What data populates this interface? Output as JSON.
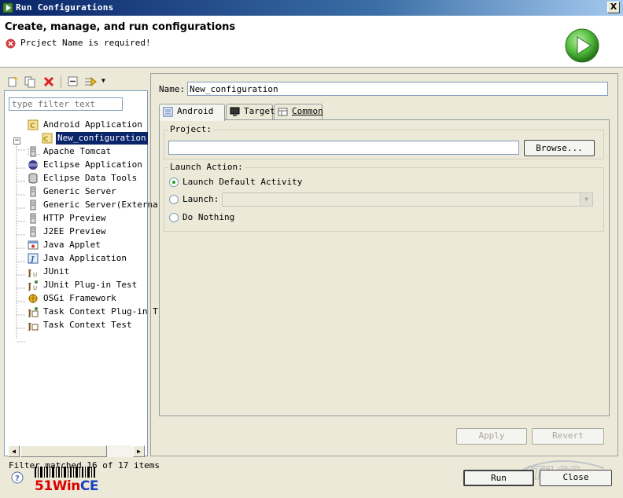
{
  "window": {
    "title": "Run Configurations",
    "close_glyph": "X"
  },
  "banner": {
    "title": "Create, manage, and run configurations",
    "error_message": "Prcject Name is required!"
  },
  "left": {
    "filter_placeholder": "type filter text",
    "tree": [
      {
        "label": "Android Application",
        "icon": "android-app-icon"
      },
      {
        "label": "New_configuration",
        "icon": "configuration-icon"
      },
      {
        "label": "Apache Tomcat",
        "icon": "server-icon"
      },
      {
        "label": "Eclipse Application",
        "icon": "eclipse-icon"
      },
      {
        "label": "Eclipse Data Tools",
        "icon": "database-icon"
      },
      {
        "label": "Generic Server",
        "icon": "server-icon"
      },
      {
        "label": "Generic Server(Externa",
        "icon": "server-icon"
      },
      {
        "label": "HTTP Preview",
        "icon": "server-icon"
      },
      {
        "label": "J2EE Preview",
        "icon": "server-icon"
      },
      {
        "label": "Java Applet",
        "icon": "applet-icon"
      },
      {
        "label": "Java Application",
        "icon": "java-app-icon"
      },
      {
        "label": "JUnit",
        "icon": "junit-icon"
      },
      {
        "label": "JUnit Plug-in Test",
        "icon": "junit-plugin-icon"
      },
      {
        "label": "OSGi Framework",
        "icon": "osgi-icon"
      },
      {
        "label": "Task Context Plug-in T",
        "icon": "task-context-plugin-icon"
      },
      {
        "label": "Task Context Test",
        "icon": "task-context-icon"
      }
    ],
    "filter_status": "Filter matched 16 of 17 items"
  },
  "right": {
    "name_label": "Name:",
    "name_value": "New_configuration",
    "tabs": [
      {
        "label": "Android",
        "icon": "android-tab-icon"
      },
      {
        "label": "Target",
        "icon": "monitor-icon"
      },
      {
        "label": "Common",
        "icon": "common-icon"
      }
    ],
    "project_group": "Project:",
    "browse_label": "Browse...",
    "launch_group": "Launch Action:",
    "radio_default": "Launch Default Activity",
    "radio_launch": "Launch:",
    "radio_nothing": "Do Nothing",
    "apply_label": "Apply",
    "revert_label": "Revert"
  },
  "footer": {
    "run_label": "Run",
    "close_label": "Close",
    "logo_main": "51Win",
    "logo_accent": "CE",
    "watermark": "IT168"
  },
  "colors": {
    "selection": "#0a246a",
    "error": "#d04040",
    "run_green": "#3aa52a",
    "logo_red": "#dd0000",
    "logo_blue": "#1a3fbf"
  }
}
